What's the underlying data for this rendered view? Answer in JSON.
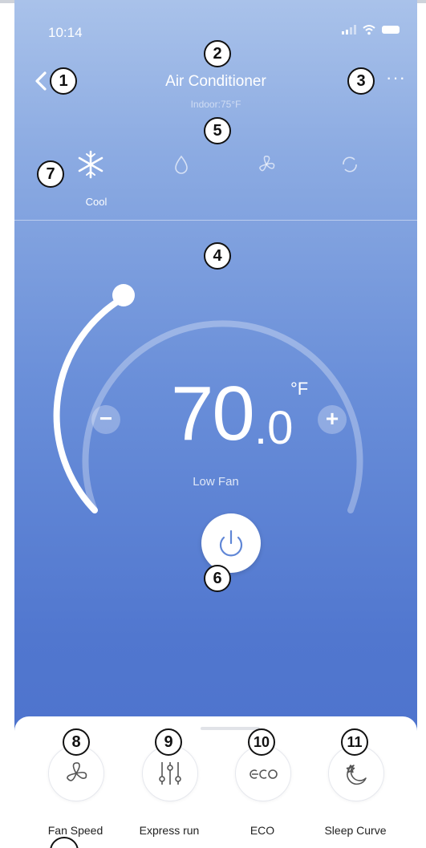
{
  "status": {
    "time": "10:14"
  },
  "header": {
    "title": "Air Conditioner",
    "subtitle": "Indoor:75°F",
    "more": "···"
  },
  "modes": {
    "active_label": "Cool"
  },
  "thermostat": {
    "temp_whole": "70",
    "temp_decimal": ".0",
    "unit": "°F",
    "fan_mode": "Low Fan",
    "minus": "−",
    "plus": "+"
  },
  "features": [
    {
      "label": "Fan Speed",
      "icon": "fan-icon"
    },
    {
      "label": "Express run",
      "icon": "sliders-icon"
    },
    {
      "label": "ECO",
      "icon": "eco-icon"
    },
    {
      "label": "Sleep Curve",
      "icon": "moon-star-icon"
    }
  ],
  "callouts": [
    "1",
    "2",
    "3",
    "4",
    "5",
    "6",
    "7",
    "8",
    "9",
    "10",
    "11"
  ],
  "colors": {
    "bg_top": "#a9c2ea",
    "bg_bottom": "#4b70cb",
    "text": "#ffffff"
  }
}
